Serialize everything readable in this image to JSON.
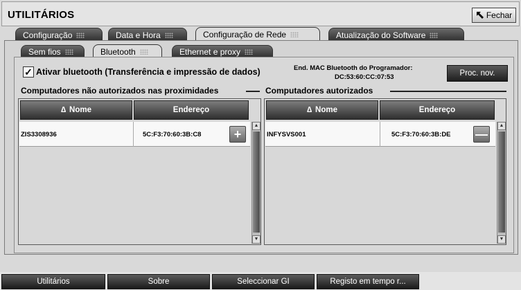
{
  "app": {
    "title": "UTILITÁRIOS",
    "close_label": "Fechar"
  },
  "tabs": [
    {
      "label": "Configuração",
      "active": false
    },
    {
      "label": "Data e Hora",
      "active": false
    },
    {
      "label": "Configuração de Rede",
      "active": true
    },
    {
      "label": "Atualização do Software",
      "active": false
    }
  ],
  "subtabs": [
    {
      "label": "Sem fios",
      "active": false
    },
    {
      "label": "Bluetooth",
      "active": true
    },
    {
      "label": "Ethernet e proxy",
      "active": false
    }
  ],
  "bluetooth": {
    "enable_label": "Ativar bluetooth (Transferência e impressão de dados)",
    "enable_checked": true,
    "mac_label": "End. MAC Bluetooth do Programador:",
    "mac_value": "DC:53:60:CC:07:53",
    "search_button": "Proc. nov."
  },
  "unauthorized": {
    "title": "Computadores não autorizados nas proximidades",
    "col_name": "Nome",
    "col_address": "Endereço",
    "rows": [
      {
        "name": "ZIS3308936",
        "address": "5C:F3:70:60:3B:C8",
        "action": "+"
      }
    ]
  },
  "authorized": {
    "title": "Computadores autorizados",
    "col_name": "Nome",
    "col_address": "Endereço",
    "rows": [
      {
        "name": "INFYSVS001",
        "address": "5C:F3:70:60:3B:DE",
        "action": "—"
      }
    ]
  },
  "bottom_nav": [
    "Utilitários",
    "Sobre",
    "Seleccionar GI",
    "Registo em tempo r..."
  ]
}
